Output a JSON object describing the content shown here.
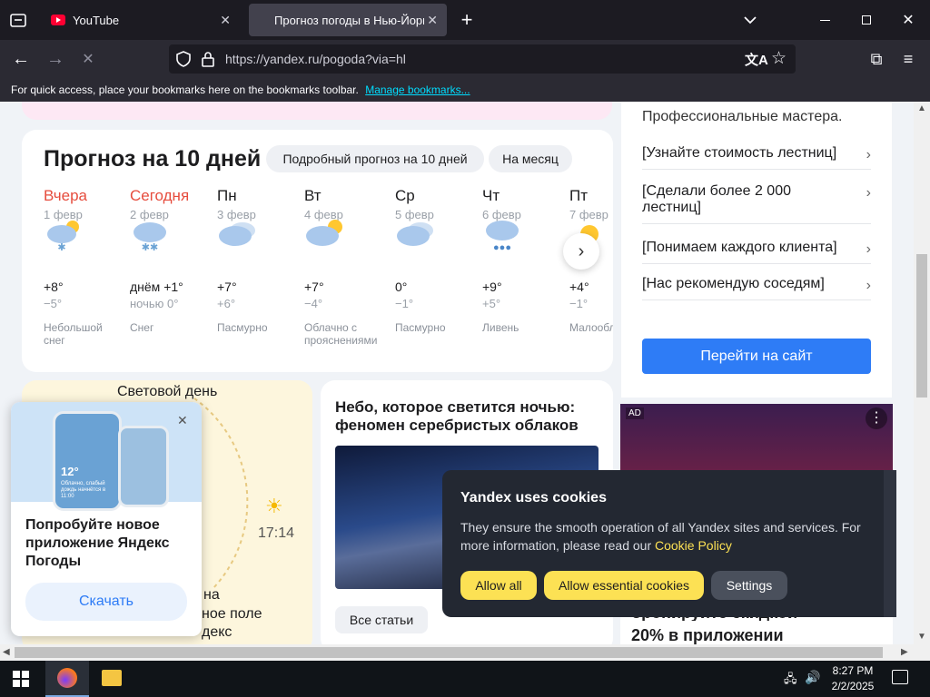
{
  "browser": {
    "tabs": [
      {
        "title": "YouTube"
      },
      {
        "title": "Прогноз погоды в Нью-Йорке"
      }
    ],
    "url": "https://yandex.ru/pogoda?via=hl",
    "bookmarks_hint": "For quick access, place your bookmarks here on the bookmarks toolbar.",
    "manage_bookmarks": "Manage bookmarks..."
  },
  "forecast": {
    "title": "Прогноз на 10 дней",
    "detailed_btn": "Подробный прогноз на 10 дней",
    "month_btn": "На месяц",
    "days": [
      {
        "name": "Вчера",
        "date": "1 февр",
        "icon": "snow-sun-icon",
        "hi": "+8°",
        "lo": "−5°",
        "cond": "Небольшой снег",
        "red": true
      },
      {
        "name": "Сегодня",
        "date": "2 февр",
        "icon": "snow-cloud-icon",
        "hi": "днём +1°",
        "lo": "ночью 0°",
        "cond": "Снег",
        "red": true
      },
      {
        "name": "Пн",
        "date": "3 февр",
        "icon": "overcast-icon",
        "hi": "+7°",
        "lo": "+6°",
        "cond": "Пасмурно",
        "red": false
      },
      {
        "name": "Вт",
        "date": "4 февр",
        "icon": "partly-cloudy-icon",
        "hi": "+7°",
        "lo": "−4°",
        "cond": "Облачно с прояснениями",
        "red": false
      },
      {
        "name": "Ср",
        "date": "5 февр",
        "icon": "overcast-icon",
        "hi": "0°",
        "lo": "−1°",
        "cond": "Пасмурно",
        "red": false
      },
      {
        "name": "Чт",
        "date": "6 февр",
        "icon": "rain-icon",
        "hi": "+9°",
        "lo": "+5°",
        "cond": "Ливень",
        "red": false
      },
      {
        "name": "Пт",
        "date": "7 февр",
        "icon": "sun-icon",
        "hi": "+4°",
        "lo": "−1°",
        "cond": "Малооблачно",
        "red": false
      }
    ]
  },
  "ad_side": {
    "top_text": "Профессиональные мастера.",
    "links": [
      "[Узнайте стоимость лестниц]",
      "[Сделали более 2 000 лестниц]",
      "[Понимаем каждого клиента]",
      "[Нас рекомендую соседям]"
    ],
    "cta": "Перейти на сайт",
    "ad_badge": "AD",
    "ad_bottom": "20% в приложении",
    "ad_bottom_partial": "бронируйте скидкой"
  },
  "daylight": {
    "title": "Световой день",
    "sunset": "17:14",
    "partial1": "на",
    "partial2": "ное поле",
    "partial3": "декс"
  },
  "article": {
    "title": "Небо, которое светится ночью: феномен серебристых облаков",
    "all_articles": "Все статьи"
  },
  "promo": {
    "phone_temp": "12°",
    "phone_text": "Облачно, слабый дождь начнётся в 11:00",
    "text": "Попробуйте новое приложение Яндекс Погоды",
    "download": "Скачать"
  },
  "cookies": {
    "title": "Yandex uses cookies",
    "body": "They ensure the smooth operation of all Yandex sites and services. For more information, please read our",
    "link": "Cookie Policy",
    "allow_all": "Allow all",
    "allow_essential": "Allow essential cookies",
    "settings": "Settings"
  },
  "taskbar": {
    "time": "8:27 PM",
    "date": "2/2/2025"
  },
  "colors": {
    "accent": "#2e7cf6",
    "cookie_btn": "#fce154",
    "today": "#e64c3d"
  }
}
